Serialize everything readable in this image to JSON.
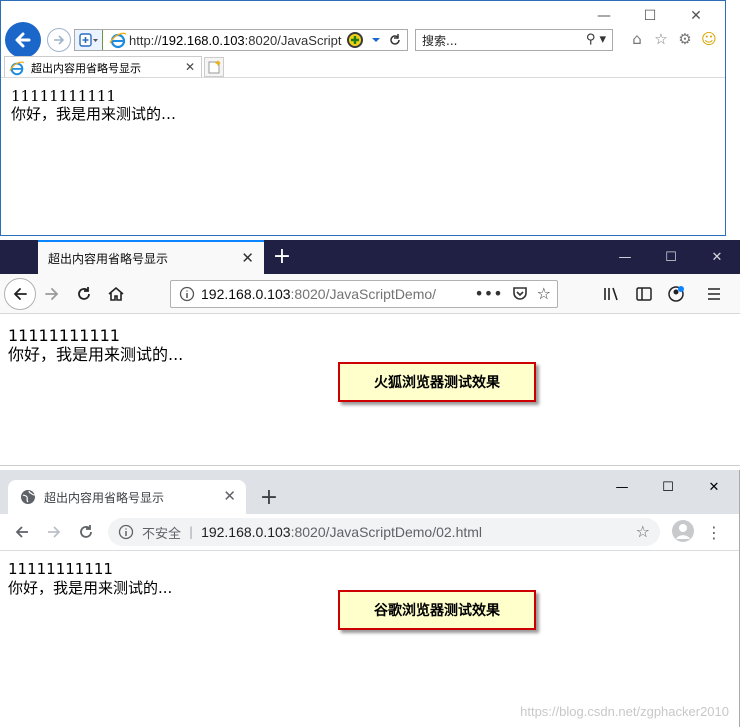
{
  "ie": {
    "url_prefix": "http://",
    "url_host": "192.168.0.103",
    "url_rest": ":8020/JavaScript",
    "search_placeholder": "搜索...",
    "tab_title": "超出内容用省略号显示",
    "content_line1": "11111111111",
    "content_line2": "你好，我是用来测试的…"
  },
  "firefox": {
    "tab_title": "超出内容用省略号显示",
    "url_host": "192.168.0.103",
    "url_rest": ":8020/JavaScriptDemo/",
    "content_line1": "11111111111",
    "content_line2": "你好，我是用来测试的..."
  },
  "chrome": {
    "tab_title": "超出内容用省略号显示",
    "insecure_label": "不安全",
    "url_host": "192.168.0.103",
    "url_rest": ":8020/JavaScriptDemo/02.html",
    "content_line1": "11111111111",
    "content_line2": "你好，我是用来测试的..."
  },
  "annotations": {
    "firefox_label": "火狐浏览器测试效果",
    "chrome_label": "谷歌浏览器测试效果"
  },
  "watermark": "https://blog.csdn.net/zgphacker2010",
  "colors": {
    "ie_back_button": "#1b66c9",
    "firefox_titlebar": "#1f2044",
    "firefox_tab_accent": "#0a84ff",
    "chrome_titlebar": "#dee1e6",
    "annotation_bg": "#ffffcc",
    "annotation_border": "#cc0000"
  },
  "icons": [
    "back-arrow-icon",
    "forward-arrow-icon",
    "shield-icon",
    "ie-logo-icon",
    "refresh-icon",
    "search-icon",
    "home-icon",
    "star-icon",
    "gear-icon",
    "smiley-icon",
    "close-icon",
    "plus-icon",
    "info-icon",
    "library-icon",
    "sidebar-icon",
    "menu-icon",
    "pocket-icon",
    "globe-icon",
    "avatar-icon",
    "kebab-menu-icon"
  ]
}
